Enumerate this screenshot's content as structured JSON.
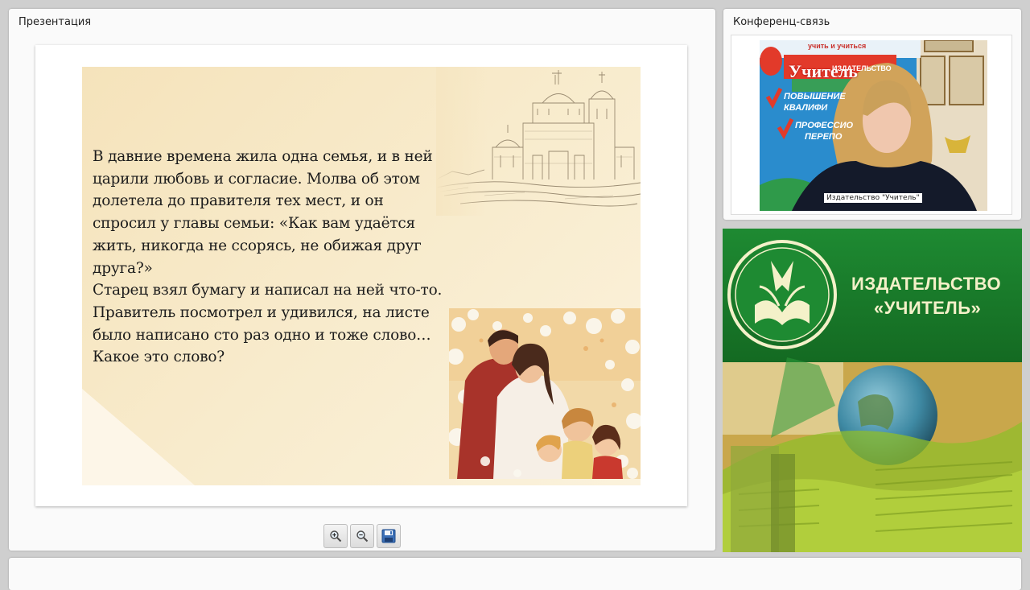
{
  "presentation": {
    "title": "Презентация",
    "slide_text": "В давние времена жила одна семья, и в ней\nцарили любовь и согласие. Молва об этом\nдолетела до правителя тех мест, и он\nспросил у главы семьи: «Как вам удаётся\nжить, никогда не ссорясь, не обижая друг\nдруга?»\nСтарец взял бумагу и написал на ней что-то.\nПравитель посмотрел и удивился, на листе\nбыло написано сто раз одно и тоже слово…\nКакое это слово?",
    "toolbar": {
      "zoom_in_icon": "zoom-in-icon",
      "zoom_out_icon": "zoom-out-icon",
      "save_icon": "save-icon"
    }
  },
  "conference": {
    "title": "Конференц-связь",
    "participant_name": "Издательство \"Учитель\"",
    "banner": {
      "brand": "Учитель",
      "sub": "издательство",
      "line1": "повышение",
      "line2": "квалифи",
      "line3": "профессио",
      "line4": "перепо",
      "top": "учить и учиться"
    }
  },
  "brand_panel": {
    "line1": "ИЗДАТЕЛЬСТВО",
    "line2": "«УЧИТЕЛЬ»",
    "colors": {
      "green": "#1a7a2a",
      "lime": "#b6d640"
    }
  }
}
